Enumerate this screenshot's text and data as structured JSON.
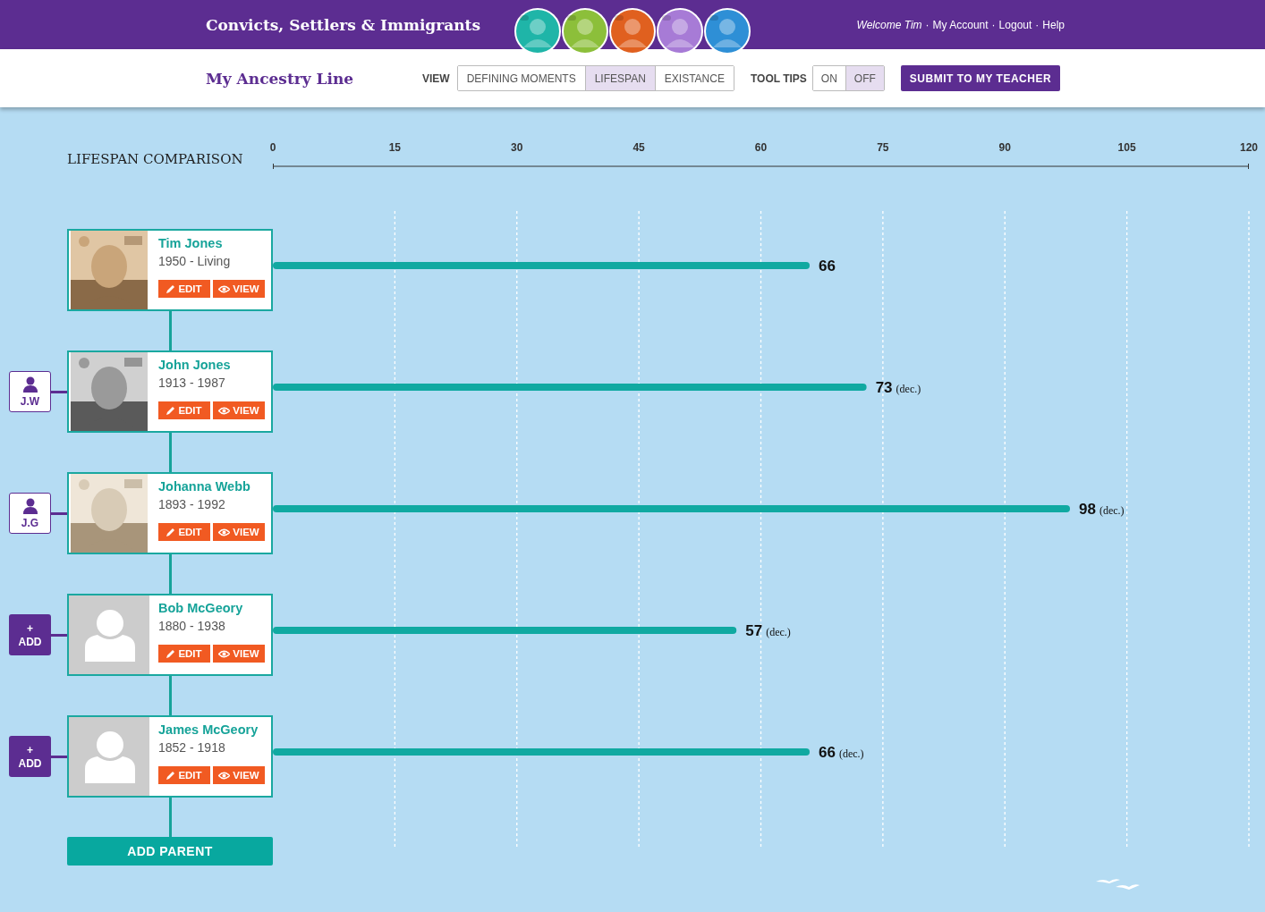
{
  "header": {
    "site_title": "Convicts, Settlers & Immigrants",
    "avatars": [
      {
        "color": "#1fb5a8"
      },
      {
        "color": "#8cbf3a"
      },
      {
        "color": "#e0601f"
      },
      {
        "color": "#a77bd6"
      },
      {
        "color": "#2e8fd6"
      }
    ],
    "welcome": "Welcome Tim",
    "separator": "·",
    "links": [
      "My Account",
      "Logout",
      "Help"
    ]
  },
  "toolbar": {
    "page_title": "My Ancestry Line",
    "view_label": "VIEW",
    "view_options": [
      {
        "label": "DEFINING MOMENTS",
        "selected": false
      },
      {
        "label": "LIFESPAN",
        "selected": true
      },
      {
        "label": "EXISTANCE",
        "selected": false
      }
    ],
    "tooltips_label": "TOOL TIPS",
    "tooltip_options": [
      {
        "label": "ON",
        "selected": false
      },
      {
        "label": "OFF",
        "selected": true
      }
    ],
    "submit": "SUBMIT TO MY TEACHER"
  },
  "comparison_title": "LIFESPAN COMPARISON",
  "axis_ticks": [
    "0",
    "15",
    "30",
    "45",
    "60",
    "75",
    "90",
    "105",
    "120"
  ],
  "people": [
    {
      "name": "Tim Jones",
      "dates": "1950 - Living",
      "kind": "picture",
      "age": "66",
      "level": 0.55,
      "edit": "EDIT",
      "view": "VIEW"
    },
    {
      "name": "John Jones",
      "dates": "1913 - 1987",
      "kind": "picture",
      "age": "73",
      "note": "(dec.)",
      "level": 0.6083,
      "side": {
        "kind": "initials",
        "label": "J.W"
      },
      "edit": "EDIT",
      "view": "VIEW"
    },
    {
      "name": "Johanna Webb",
      "dates": "1893 - 1992",
      "kind": "picture",
      "age": "98",
      "note": "(dec.)",
      "level": 0.8167,
      "side": {
        "kind": "initials",
        "label": "J.G"
      },
      "edit": "EDIT",
      "view": "VIEW"
    },
    {
      "name": "Bob McGeory",
      "dates": "1880 - 1938",
      "kind": "placeholder",
      "age": "57",
      "note": "(dec.)",
      "level": 0.475,
      "side": {
        "kind": "add",
        "symbol": "+",
        "label": "ADD"
      },
      "edit": "EDIT",
      "view": "VIEW"
    },
    {
      "name": "James McGeory",
      "dates": "1852 - 1918",
      "kind": "placeholder",
      "age": "66",
      "note": "(dec.)",
      "level": 0.55,
      "side": {
        "kind": "add",
        "symbol": "+",
        "label": "ADD"
      },
      "edit": "EDIT",
      "view": "VIEW"
    }
  ],
  "add_parent": "ADD PARENT"
}
